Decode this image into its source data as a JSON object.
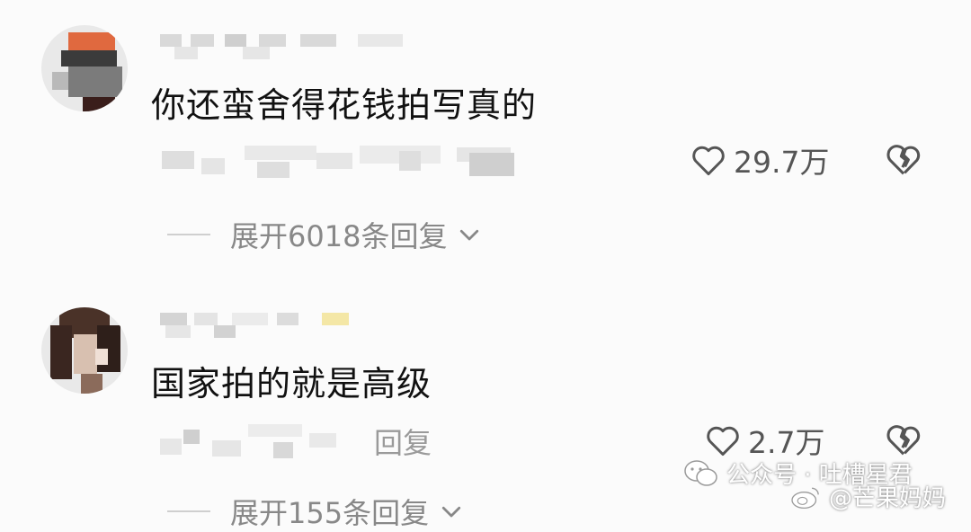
{
  "comments": [
    {
      "text": "你还蛮舍得花钱拍写真的",
      "likes": "29.7万",
      "expand_label": "展开6018条回复"
    },
    {
      "text": "国家拍的就是高级",
      "reply_label": "回复",
      "likes": "2.7万",
      "expand_label": "展开155条回复"
    }
  ],
  "watermarks": {
    "wechat": "公众号 · 吐槽星君",
    "weibo": "@芒果妈妈"
  },
  "icons": {
    "like": "heart-outline-icon",
    "dislike": "broken-heart-icon",
    "expand": "chevron-down-icon"
  },
  "colors": {
    "background": "#fbfbfb",
    "text": "#111111",
    "meta": "#888888",
    "icon": "#555555"
  }
}
